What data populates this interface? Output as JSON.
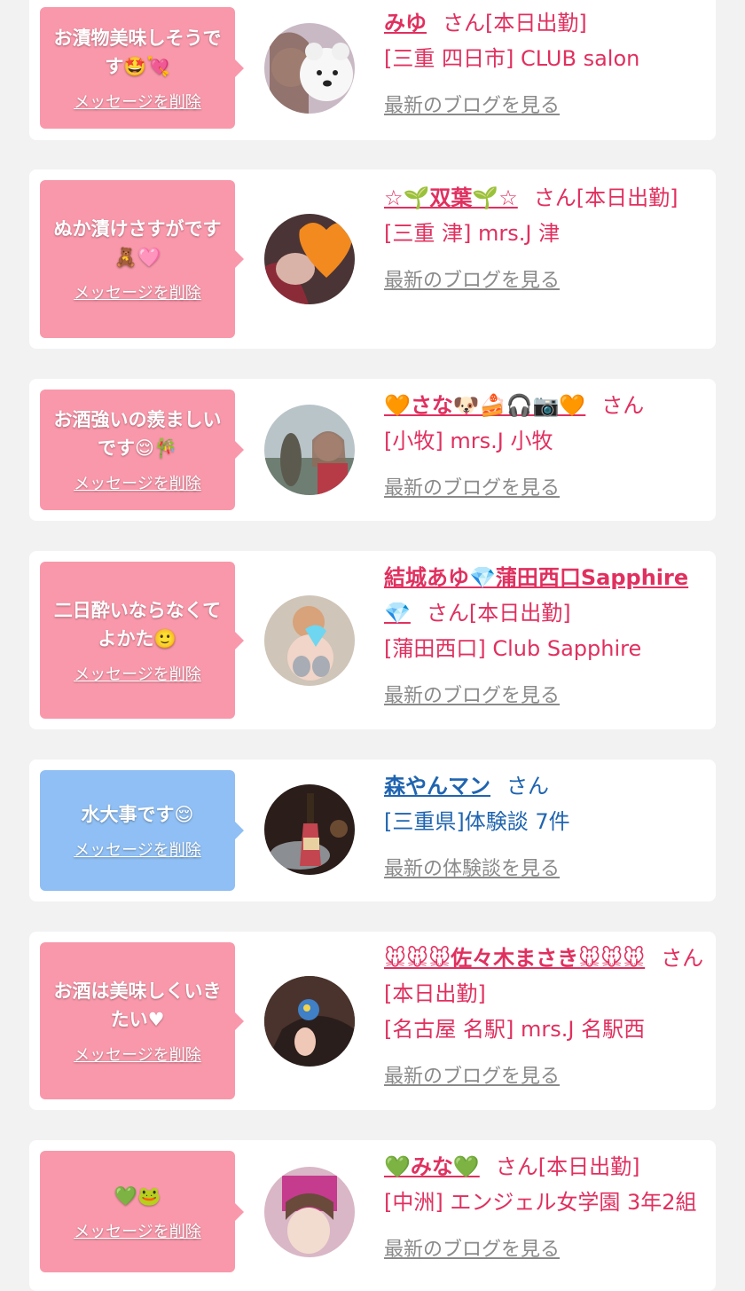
{
  "cards": [
    {
      "message": "お漬物美味しそうです🤩💘",
      "delete_label": "メッセージを削除",
      "name": "みゆ",
      "suffix": "さん[本日出勤]",
      "shop": "[三重 四日市] CLUB salon",
      "link": "最新のブログを見る"
    },
    {
      "message": "ぬか漬けさすがです🧸🩷",
      "delete_label": "メッセージを削除",
      "name": "☆🌱双葉🌱☆",
      "suffix": "さん[本日出勤]",
      "shop": "[三重 津] mrs.J 津",
      "link": "最新のブログを見る"
    },
    {
      "message": "お酒強いの羨ましいです😌🎋",
      "delete_label": "メッセージを削除",
      "name": "🧡さな🐶🍰🎧📷🧡",
      "suffix": "さん",
      "shop": "[小牧] mrs.J 小牧",
      "link": "最新のブログを見る"
    },
    {
      "message": "二日酔いならなくてよかた🙂",
      "delete_label": "メッセージを削除",
      "name": "結城あゆ💎蒲田西口Sapphire💎",
      "suffix": "さん[本日出勤]",
      "shop": "[蒲田西口] Club Sapphire",
      "link": "最新のブログを見る"
    },
    {
      "message": "水大事です😌",
      "delete_label": "メッセージを削除",
      "name": "森やんマン",
      "suffix": "さん",
      "shop": "[三重県]体験談 7件",
      "link": "最新の体験談を見る"
    },
    {
      "message": "お酒は美味しくいきたい♥",
      "delete_label": "メッセージを削除",
      "name": "🐭🐭🐭佐々木まさき🐭🐭🐭",
      "suffix": "さん[本日出勤]",
      "shop": "[名古屋 名駅] mrs.J 名駅西",
      "link": "最新のブログを見る"
    },
    {
      "message": "💚🐸",
      "delete_label": "メッセージを削除",
      "name": "💚みな💚",
      "suffix": "さん[本日出勤]",
      "shop": "[中洲] エンジェル女学園 3年2組",
      "link": "最新のブログを見る"
    }
  ],
  "colors": {
    "cast_text": "#e0305f",
    "customer_text": "#1f64b0",
    "bubble_pink": "#f998ab",
    "bubble_blue": "#8fbff4",
    "link_gray": "#8a8a8a"
  }
}
